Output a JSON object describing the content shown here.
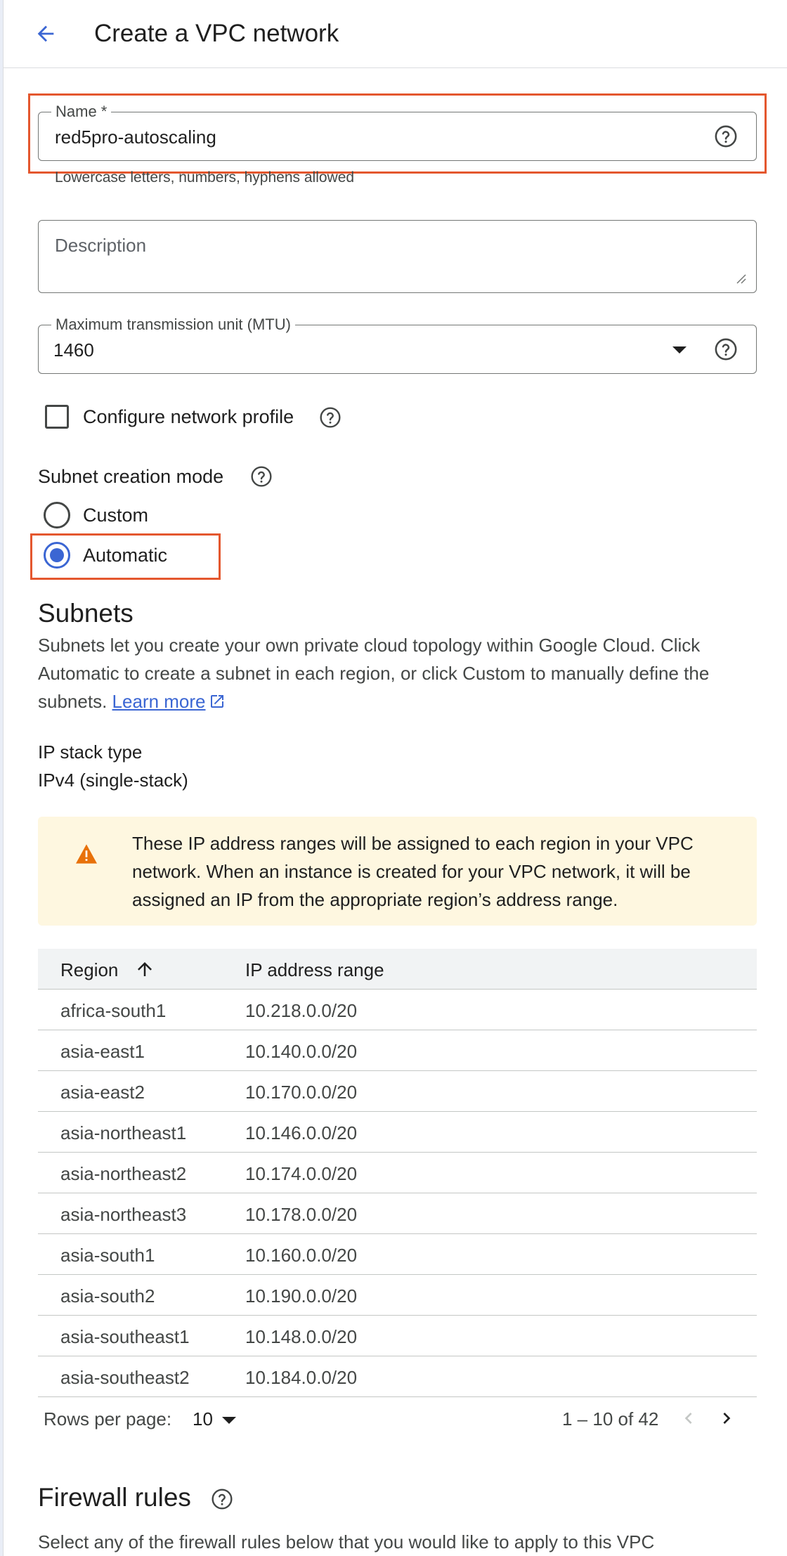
{
  "header": {
    "title": "Create a VPC network"
  },
  "name_field": {
    "label": "Name *",
    "value": "red5pro-autoscaling",
    "hint": "Lowercase letters, numbers, hyphens allowed"
  },
  "description_field": {
    "placeholder": "Description"
  },
  "mtu_field": {
    "label": "Maximum transmission unit (MTU)",
    "value": "1460"
  },
  "network_profile": {
    "label": "Configure network profile",
    "checked": false
  },
  "subnet_mode": {
    "label": "Subnet creation mode",
    "options": [
      {
        "label": "Custom",
        "selected": false
      },
      {
        "label": "Automatic",
        "selected": true
      }
    ]
  },
  "subnets": {
    "title": "Subnets",
    "description": "Subnets let you create your own private cloud topology within Google Cloud. Click Automatic to create a subnet in each region, or click Custom to manually define the subnets.",
    "learn_more": "Learn more"
  },
  "ip_stack": {
    "label": "IP stack type",
    "value": "IPv4 (single-stack)"
  },
  "warning": {
    "text": "These IP address ranges will be assigned to each region in your VPC network. When an instance is created for your VPC network, it will be assigned an IP from the appropriate region’s address range."
  },
  "table": {
    "columns": [
      "Region",
      "IP address range"
    ],
    "rows": [
      [
        "africa-south1",
        "10.218.0.0/20"
      ],
      [
        "asia-east1",
        "10.140.0.0/20"
      ],
      [
        "asia-east2",
        "10.170.0.0/20"
      ],
      [
        "asia-northeast1",
        "10.146.0.0/20"
      ],
      [
        "asia-northeast2",
        "10.174.0.0/20"
      ],
      [
        "asia-northeast3",
        "10.178.0.0/20"
      ],
      [
        "asia-south1",
        "10.160.0.0/20"
      ],
      [
        "asia-south2",
        "10.190.0.0/20"
      ],
      [
        "asia-southeast1",
        "10.148.0.0/20"
      ],
      [
        "asia-southeast2",
        "10.184.0.0/20"
      ]
    ]
  },
  "pagination": {
    "rows_label": "Rows per page:",
    "rows_value": "10",
    "range": "1 – 10 of 42"
  },
  "firewall": {
    "title": "Firewall rules",
    "description": "Select any of the firewall rules below that you would like to apply to this VPC"
  },
  "colors": {
    "accent": "#3b66d3",
    "highlight": "#e4572e",
    "warning_bg": "#fef7e0",
    "warning_icon": "#e8710a"
  },
  "icons": {
    "back": "arrow-back-icon",
    "help": "help-circle-icon",
    "warning": "warning-triangle-icon",
    "sort": "arrow-up-icon",
    "prev": "chevron-left-icon",
    "next": "chevron-right-icon",
    "external": "open-in-new-icon",
    "dropdown": "caret-down-icon"
  }
}
